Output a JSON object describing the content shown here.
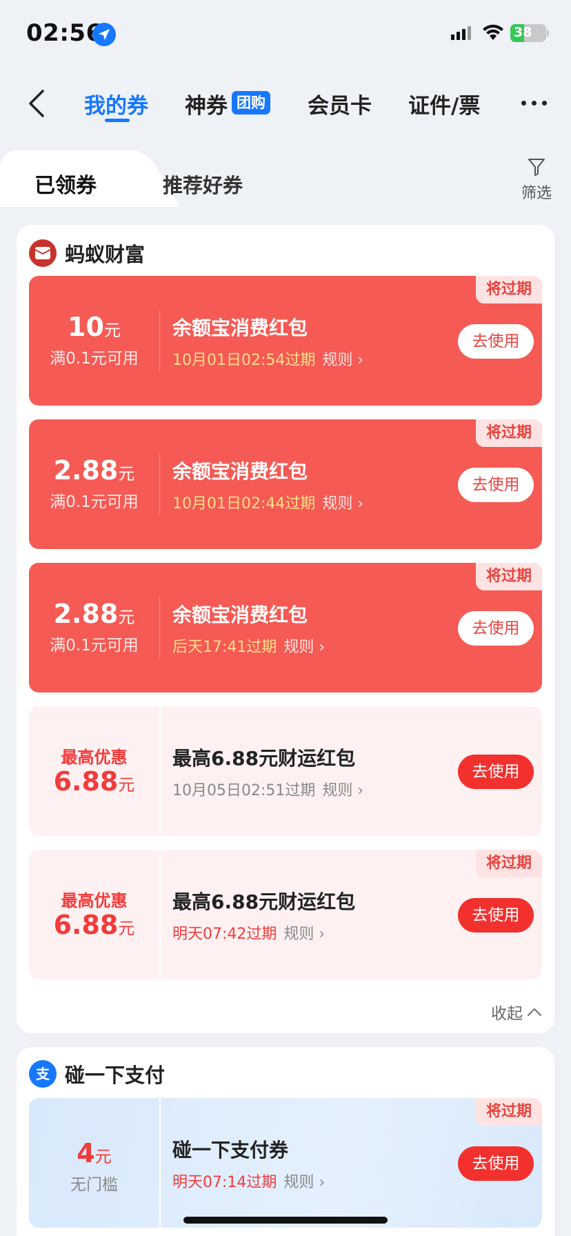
{
  "status_bar": {
    "time": "02:56",
    "battery": "38",
    "battery_level": 0.38
  },
  "nav": {
    "tabs": [
      {
        "label": "我的券",
        "active": true
      },
      {
        "label": "神券",
        "badge": "团购"
      },
      {
        "label": "会员卡"
      },
      {
        "label": "证件/票"
      }
    ]
  },
  "subtabs": {
    "received": "已领券",
    "recommended": "推荐好券",
    "filter": "筛选"
  },
  "sections": [
    {
      "title": "蚂蚁财富",
      "coupons": [
        {
          "amount": "10",
          "unit": "元",
          "condition": "满0.1元可用",
          "title": "余额宝消费红包",
          "expire": "10月01日02:54过期",
          "rule": "规则",
          "button": "去使用",
          "tag": "将过期"
        },
        {
          "amount": "2.88",
          "unit": "元",
          "condition": "满0.1元可用",
          "title": "余额宝消费红包",
          "expire": "10月01日02:44过期",
          "rule": "规则",
          "button": "去使用",
          "tag": "将过期"
        },
        {
          "amount": "2.88",
          "unit": "元",
          "condition": "满0.1元可用",
          "title": "余额宝消费红包",
          "expire": "后天17:41过期",
          "rule": "规则",
          "button": "去使用",
          "tag": "将过期"
        },
        {
          "top_label": "最高优惠",
          "amount": "6.88",
          "unit": "元",
          "title": "最高6.88元财运红包",
          "expire": "10月05日02:51过期",
          "rule": "规则",
          "button": "去使用"
        },
        {
          "top_label": "最高优惠",
          "amount": "6.88",
          "unit": "元",
          "title": "最高6.88元财运红包",
          "expire": "明天07:42过期",
          "rule": "规则",
          "button": "去使用",
          "tag": "将过期"
        }
      ],
      "collapse": "收起"
    },
    {
      "title": "碰一下支付",
      "coupons": [
        {
          "amount": "4",
          "unit": "元",
          "condition": "无门槛",
          "title": "碰一下支付券",
          "expire": "明天07:14过期",
          "rule": "规则",
          "button": "去使用",
          "tag": "将过期"
        }
      ]
    }
  ],
  "colors": {
    "accent": "#1677ff",
    "coupon_red": "#f55a54",
    "button_red": "#f2312e"
  }
}
